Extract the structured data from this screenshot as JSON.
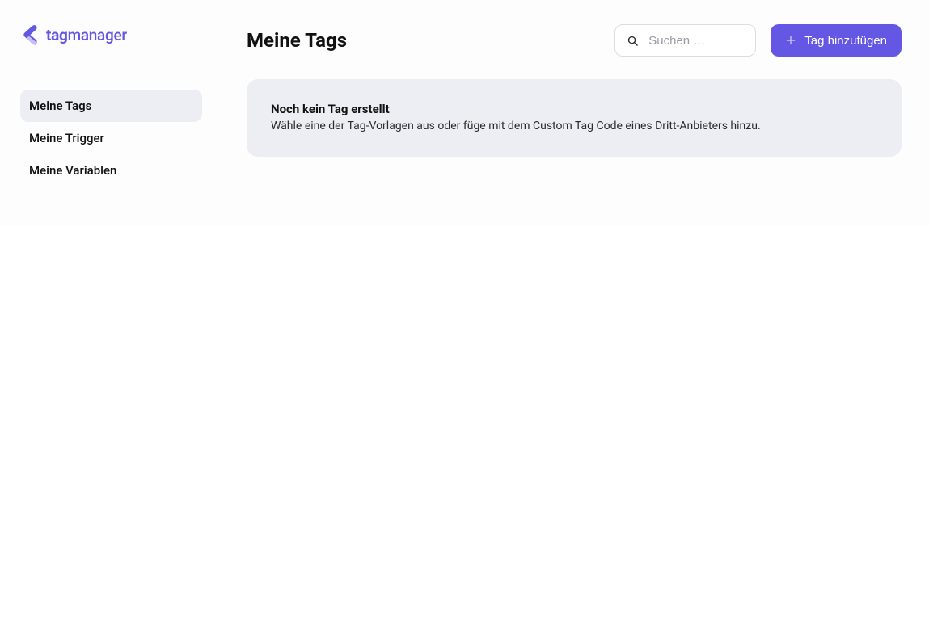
{
  "brand": {
    "part1": "tag",
    "part2": "manager"
  },
  "sidebar": {
    "items": [
      {
        "label": "Meine Tags",
        "active": true
      },
      {
        "label": "Meine Trigger",
        "active": false
      },
      {
        "label": "Meine Variablen",
        "active": false
      }
    ]
  },
  "header": {
    "title": "Meine Tags"
  },
  "search": {
    "placeholder": "Suchen …"
  },
  "actions": {
    "add_tag_label": "Tag hinzufügen"
  },
  "empty_state": {
    "title": "Noch kein Tag erstellt",
    "description": "Wähle eine der Tag-Vorlagen aus oder füge mit dem Custom Tag Code eines Dritt-Anbieters hinzu."
  }
}
